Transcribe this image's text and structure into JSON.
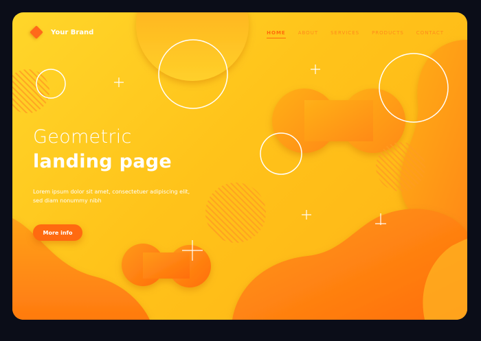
{
  "brand": {
    "name": "Your Brand",
    "logo_icon": "diamond-logo-icon",
    "logo_color": "#ff6a1a"
  },
  "nav": {
    "items": [
      {
        "label": "HOME",
        "active": true
      },
      {
        "label": "ABOUT",
        "active": false
      },
      {
        "label": "SERVICES",
        "active": false
      },
      {
        "label": "PRODUCTS",
        "active": false
      },
      {
        "label": "CONTACT",
        "active": false
      }
    ]
  },
  "hero": {
    "title_light": "Geometric",
    "title_bold": "landing page",
    "description": "Lorem ipsum dolor sit amet, consectetuer adipiscing elit, sed diam nonummy nibh",
    "button_label": "More info"
  },
  "colors": {
    "background": "#ffc31a",
    "accent": "#ff6a10",
    "text": "#ffffff",
    "page_backdrop": "#0b0d18"
  }
}
